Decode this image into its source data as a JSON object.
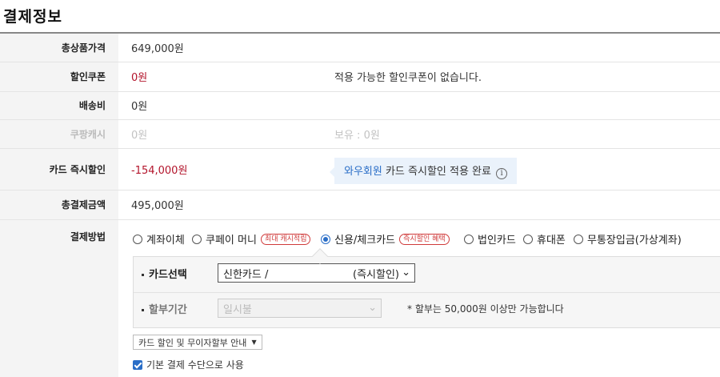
{
  "page": {
    "title": "결제정보"
  },
  "summary": {
    "product_total_label": "총상품가격",
    "product_total_value": "649,000원",
    "coupon_label": "할인쿠폰",
    "coupon_value": "0원",
    "coupon_note": "적용 가능한 할인쿠폰이 없습니다.",
    "shipping_label": "배송비",
    "shipping_value": "0원",
    "cash_label": "쿠팡캐시",
    "cash_value": "0원",
    "cash_note": "보유 : 0원",
    "instant_label": "카드 즉시할인",
    "instant_value": "-154,000원",
    "instant_member": "와우회원",
    "instant_note": " 카드 즉시할인 적용 완료",
    "instant_info_icon": "i",
    "total_label": "총결제금액",
    "total_value": "495,000원"
  },
  "payment": {
    "label": "결제방법",
    "methods": [
      {
        "label": "계좌이체",
        "selected": false,
        "badge": ""
      },
      {
        "label": "쿠페이 머니",
        "selected": false,
        "badge": "최대 캐시적립"
      },
      {
        "label": "신용/체크카드",
        "selected": true,
        "badge": "즉시할인 혜택"
      },
      {
        "label": "법인카드",
        "selected": false,
        "badge": ""
      },
      {
        "label": "휴대폰",
        "selected": false,
        "badge": ""
      },
      {
        "label": "무통장입금(가상계좌)",
        "selected": false,
        "badge": ""
      }
    ],
    "card_select_label": "카드선택",
    "card_select_value": "신한카드 /",
    "card_select_suffix": "(즉시할인)",
    "installment_label": "할부기간",
    "installment_value": "일시불",
    "installment_hint": "* 할부는 50,000원 이상만 가능합니다",
    "guide_button": "카드 할인 및 무이자할부 안내",
    "default_checkbox_label": "기본 결제 수단으로 사용",
    "default_checked": true
  },
  "colors": {
    "accent": "#2a6ec7",
    "discount": "#b3142b",
    "badge": "#d03b3b"
  }
}
